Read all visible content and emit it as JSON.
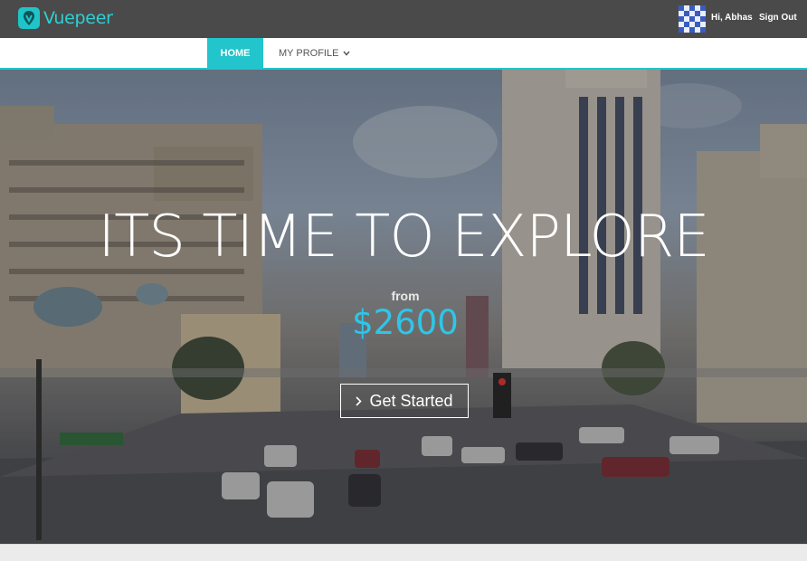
{
  "brand": {
    "name": "Vuepeer",
    "accent": "#21c5cb"
  },
  "header": {
    "greeting": "Hi, Abhas",
    "sign_out": "Sign Out"
  },
  "nav": {
    "home": "HOME",
    "profile": "MY PROFILE"
  },
  "hero": {
    "title": "ITS TIME TO EXPLORE",
    "from": "from",
    "price": "$2600",
    "cta": "Get Started",
    "price_color": "#2ec6e8"
  },
  "icons": {
    "logo": "map-pin-icon",
    "avatar": "avatar-pattern",
    "dropdown": "chevron-down-icon",
    "cta": "chevron-right-icon"
  }
}
